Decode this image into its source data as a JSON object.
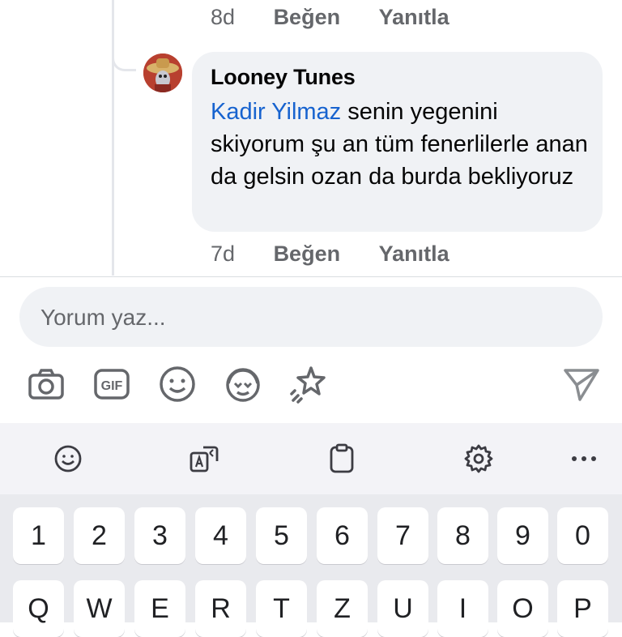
{
  "prev_comment": {
    "time": "8d",
    "like": "Beğen",
    "reply": "Yanıtla"
  },
  "reply_comment": {
    "author": "Looney Tunes",
    "mention": "Kadir Yilmaz",
    "text": " senin yegenini skiyorum şu an tüm fenerlilerle anan da gelsin ozan da burda bekliyoruz",
    "time": "7d",
    "like": "Beğen",
    "reply": "Yanıtla"
  },
  "composer": {
    "placeholder": "Yorum yaz..."
  },
  "composer_tools": [
    "camera-icon",
    "gif-icon",
    "emoji-icon",
    "avatar-sticker-icon",
    "sparkle-star-icon",
    "send-icon"
  ],
  "keyboard": {
    "toolbar": [
      "emoji-icon",
      "translate-icon",
      "clipboard-icon",
      "settings-icon",
      "more-icon"
    ],
    "number_row": [
      "1",
      "2",
      "3",
      "4",
      "5",
      "6",
      "7",
      "8",
      "9",
      "0"
    ],
    "letter_row": [
      "Q",
      "W",
      "E",
      "R",
      "T",
      "Z",
      "U",
      "I",
      "O",
      "P"
    ]
  },
  "colors": {
    "link": "#1763cf",
    "meta": "#65676b",
    "bubble": "#f0f2f5"
  }
}
